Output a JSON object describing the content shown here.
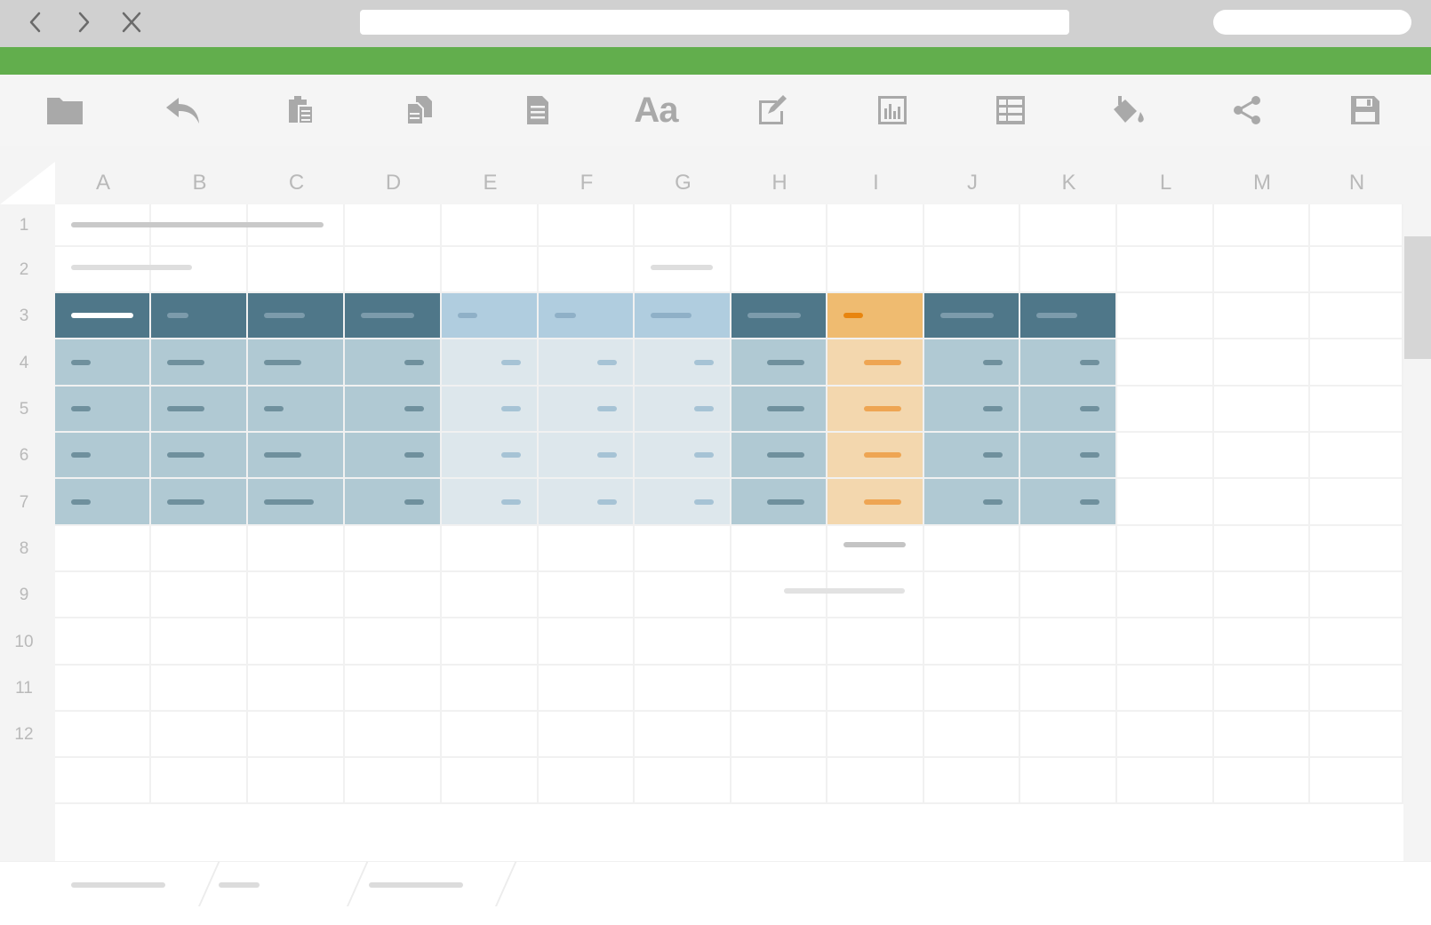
{
  "browser": {
    "back_icon": "chevron-left-icon",
    "forward_icon": "chevron-right-icon",
    "close_icon": "close-icon",
    "address": "",
    "search": ""
  },
  "colors": {
    "accent_stripe": "#62ae4d",
    "header_dark": "#4f7789",
    "header_light": "#b0cddf",
    "header_highlight": "#efbb70",
    "body_mid": "#b0c9d3",
    "body_light": "#dde7ec",
    "body_highlight": "#f3d7ae"
  },
  "toolbar": {
    "icons": [
      "folder-icon",
      "undo-icon",
      "paste-icon",
      "copy-icon",
      "document-icon",
      "font-icon",
      "edit-icon",
      "chart-icon",
      "table-icon",
      "fill-color-icon",
      "share-icon",
      "save-icon"
    ],
    "font_label": "Aa"
  },
  "sheet": {
    "columns": [
      "A",
      "B",
      "C",
      "D",
      "E",
      "F",
      "G",
      "H",
      "I",
      "J",
      "K",
      "L",
      "M",
      "N"
    ],
    "rows": [
      "1",
      "2",
      "3",
      "4",
      "5",
      "6",
      "7",
      "8",
      "9",
      "10",
      "11",
      "12"
    ]
  },
  "tabs": {
    "count": 3
  }
}
